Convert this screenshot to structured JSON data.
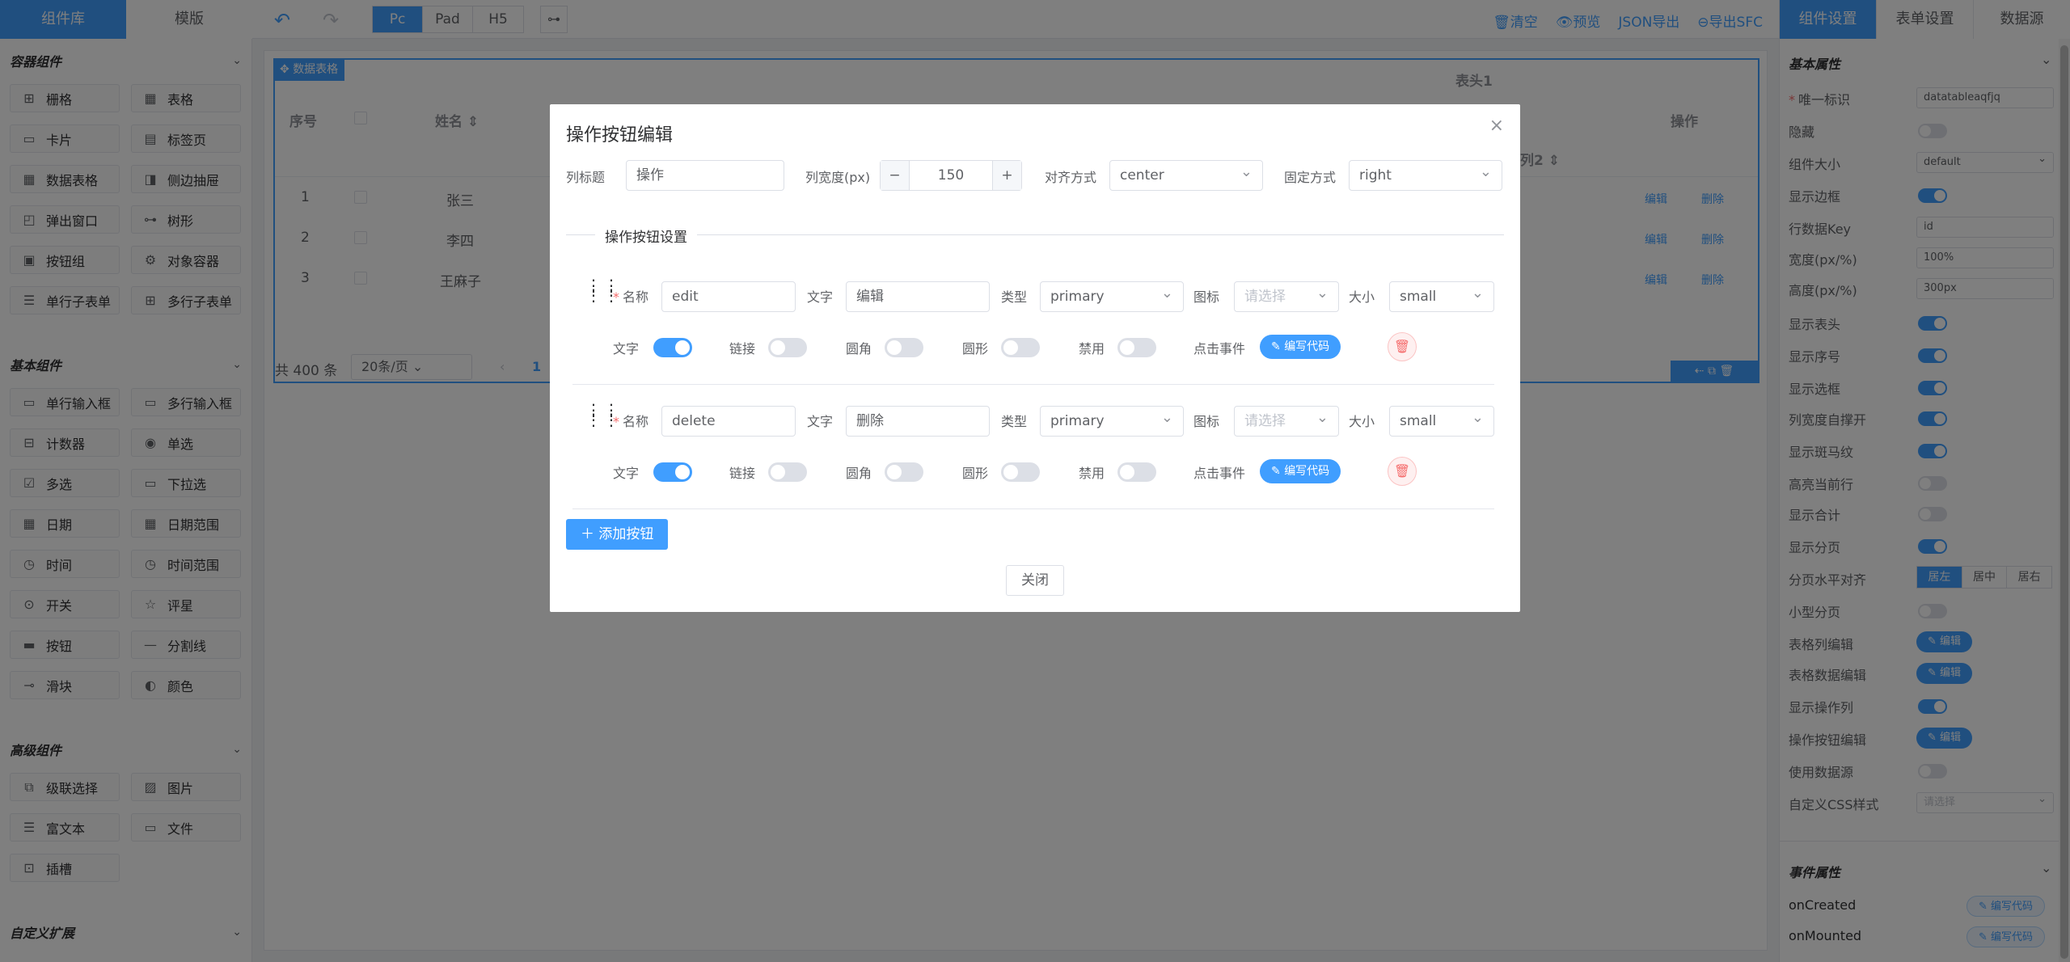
{
  "topbar": {
    "left_tabs": [
      "组件库",
      "模版"
    ],
    "device_tabs": [
      "Pc",
      "Pad",
      "H5"
    ],
    "active_device": "Pc",
    "links": [
      "清空",
      "预览",
      "JSON导出",
      "导出SFC"
    ],
    "right_tabs": [
      "组件设置",
      "表单设置",
      "数据源"
    ]
  },
  "left_panel": {
    "sections": [
      {
        "title": "容器组件",
        "items": [
          {
            "label": "栅格",
            "icon": "grid-icon"
          },
          {
            "label": "表格",
            "icon": "table-icon"
          },
          {
            "label": "卡片",
            "icon": "card-icon"
          },
          {
            "label": "标签页",
            "icon": "tabs-icon"
          },
          {
            "label": "数据表格",
            "icon": "data-table-icon"
          },
          {
            "label": "侧边抽屉",
            "icon": "drawer-icon"
          },
          {
            "label": "弹出窗口",
            "icon": "dialog-icon"
          },
          {
            "label": "树形",
            "icon": "tree-icon"
          },
          {
            "label": "按钮组",
            "icon": "button-group-icon"
          },
          {
            "label": "对象容器",
            "icon": "object-container-icon"
          },
          {
            "label": "单行子表单",
            "icon": "sub-form-icon"
          },
          {
            "label": "多行子表单",
            "icon": "grid-sub-form-icon"
          }
        ]
      },
      {
        "title": "基本组件",
        "items": [
          {
            "label": "单行输入框",
            "icon": "input-icon"
          },
          {
            "label": "多行输入框",
            "icon": "textarea-icon"
          },
          {
            "label": "计数器",
            "icon": "number-icon"
          },
          {
            "label": "单选",
            "icon": "radio-icon"
          },
          {
            "label": "多选",
            "icon": "checkbox-icon"
          },
          {
            "label": "下拉选",
            "icon": "select-icon"
          },
          {
            "label": "日期",
            "icon": "date-icon"
          },
          {
            "label": "日期范围",
            "icon": "date-range-icon"
          },
          {
            "label": "时间",
            "icon": "time-icon"
          },
          {
            "label": "时间范围",
            "icon": "time-range-icon"
          },
          {
            "label": "开关",
            "icon": "switch-icon"
          },
          {
            "label": "评星",
            "icon": "star-icon"
          },
          {
            "label": "按钮",
            "icon": "button-icon"
          },
          {
            "label": "分割线",
            "icon": "divider-icon"
          },
          {
            "label": "滑块",
            "icon": "slider-icon"
          },
          {
            "label": "颜色",
            "icon": "color-icon"
          }
        ]
      },
      {
        "title": "高级组件",
        "items": [
          {
            "label": "级联选择",
            "icon": "cascader-icon"
          },
          {
            "label": "图片",
            "icon": "image-icon"
          },
          {
            "label": "富文本",
            "icon": "rich-text-icon"
          },
          {
            "label": "文件",
            "icon": "file-icon"
          },
          {
            "label": "插槽",
            "icon": "slot-icon"
          }
        ]
      },
      {
        "title": "自定义扩展",
        "items": []
      }
    ]
  },
  "canvas": {
    "widget_label": "数据表格",
    "table": {
      "group_header": "表头1",
      "headers": [
        "序号",
        "姓名",
        "操作"
      ],
      "sub_header": "列2",
      "rows": [
        {
          "index": "1",
          "name": "张三"
        },
        {
          "index": "2",
          "name": "李四"
        },
        {
          "index": "3",
          "name": "王麻子"
        }
      ],
      "row_actions": [
        "编辑",
        "删除"
      ]
    },
    "pagination": {
      "total": "共 400 条",
      "page_size": "20条/页",
      "current_page": "1"
    }
  },
  "right_panel": {
    "basic_title": "基本属性",
    "props": [
      {
        "label": "唯一标识",
        "type": "input",
        "value": "datatableaqfjq",
        "required": true
      },
      {
        "label": "隐藏",
        "type": "switch",
        "on": false
      },
      {
        "label": "组件大小",
        "type": "select",
        "value": "default"
      },
      {
        "label": "显示边框",
        "type": "switch",
        "on": true
      },
      {
        "label": "行数据Key",
        "type": "input",
        "value": "id"
      },
      {
        "label": "宽度(px/%)",
        "type": "input",
        "value": "100%"
      },
      {
        "label": "高度(px/%)",
        "type": "input",
        "value": "300px"
      },
      {
        "label": "显示表头",
        "type": "switch",
        "on": true
      },
      {
        "label": "显示序号",
        "type": "switch",
        "on": true
      },
      {
        "label": "显示选框",
        "type": "switch",
        "on": true
      },
      {
        "label": "列宽度自撑开",
        "type": "switch",
        "on": true
      },
      {
        "label": "显示斑马纹",
        "type": "switch",
        "on": true
      },
      {
        "label": "高亮当前行",
        "type": "switch",
        "on": false
      },
      {
        "label": "显示合计",
        "type": "switch",
        "on": false
      },
      {
        "label": "显示分页",
        "type": "switch",
        "on": true
      },
      {
        "label": "分页水平对齐",
        "type": "radio",
        "options": [
          "居左",
          "居中",
          "居右"
        ],
        "selected": "居左"
      },
      {
        "label": "小型分页",
        "type": "switch",
        "on": false
      },
      {
        "label": "表格列编辑",
        "type": "button",
        "value": "编辑"
      },
      {
        "label": "表格数据编辑",
        "type": "button",
        "value": "编辑"
      },
      {
        "label": "显示操作列",
        "type": "switch",
        "on": true
      },
      {
        "label": "操作按钮编辑",
        "type": "button",
        "value": "编辑"
      },
      {
        "label": "使用数据源",
        "type": "switch",
        "on": false
      },
      {
        "label": "自定义CSS样式",
        "type": "select",
        "value": "请选择",
        "placeholder": true
      }
    ],
    "event_title": "事件属性",
    "events": [
      {
        "label": "onCreated",
        "button": "编写代码"
      },
      {
        "label": "onMounted",
        "button": "编写代码"
      }
    ]
  },
  "modal": {
    "title": "操作按钮编辑",
    "column_title_label": "列标题",
    "column_title_value": "操作",
    "column_width_label": "列宽度(px)",
    "column_width_value": "150",
    "align_label": "对齐方式",
    "align_value": "center",
    "fixed_label": "固定方式",
    "fixed_value": "right",
    "divider_text": "操作按钮设置",
    "row_labels": {
      "name": "名称",
      "text": "文字",
      "type": "类型",
      "icon": "图标",
      "size": "大小",
      "text_switch": "文字",
      "link": "链接",
      "round": "圆角",
      "circle": "圆形",
      "disabled": "禁用",
      "click": "点击事件"
    },
    "icon_placeholder": "请选择",
    "code_button": "编写代码",
    "buttons": [
      {
        "name": "edit",
        "text": "编辑",
        "type": "primary",
        "size": "small",
        "text_on": true,
        "link_on": false,
        "round_on": false,
        "circle_on": false,
        "disabled_on": false
      },
      {
        "name": "delete",
        "text": "删除",
        "type": "primary",
        "size": "small",
        "text_on": true,
        "link_on": false,
        "round_on": false,
        "circle_on": false,
        "disabled_on": false
      }
    ],
    "add_button": "添加按钮",
    "close_button": "关闭"
  }
}
